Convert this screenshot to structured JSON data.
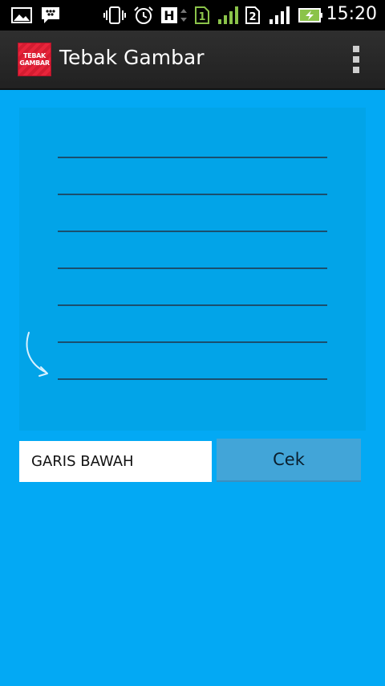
{
  "status_bar": {
    "time": "15:20",
    "network_type": "H",
    "sim1_label": "1",
    "sim2_label": "2",
    "icons": [
      "gallery-icon",
      "bbm-icon",
      "vibrate-icon",
      "alarm-icon",
      "network-type-icon",
      "sim1-icon",
      "signal1-icon",
      "sim2-icon",
      "signal2-icon",
      "battery-charging-icon"
    ]
  },
  "action_bar": {
    "logo_line1": "TEBAK",
    "logo_line2": "GAMBAR",
    "title": "Tebak Gambar",
    "menu_icon": "overflow-menu-icon"
  },
  "puzzle": {
    "line_count": 7,
    "arrow_icon": "curved-arrow-icon"
  },
  "answer": {
    "value": "GARIS BAWAH",
    "button_label": "Cek"
  },
  "colors": {
    "background": "#03a9f4",
    "image_background": "#02a4e8",
    "line": "#1a4f6e",
    "button": "#42a5d8",
    "action_bar": "#2a2a2a",
    "logo_red": "#e8253b",
    "signal_green": "#8bc34a"
  }
}
